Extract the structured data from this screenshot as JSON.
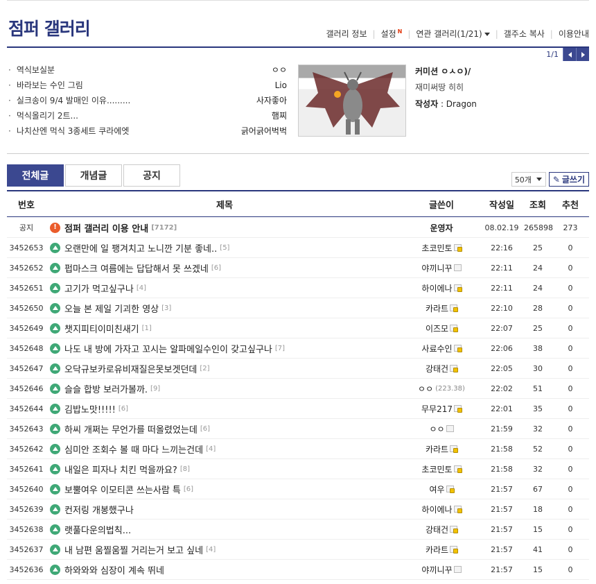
{
  "gallery": {
    "title": "점퍼 갤러리",
    "menu": [
      "갤러리 정보",
      "설정",
      "연관 갤러리(1/21)",
      "갤주소 복사",
      "이용안내"
    ],
    "settings_new_mark": "N",
    "pager": "1/1"
  },
  "concept_list": [
    {
      "title": "역식보실분",
      "author": "ㅇㅇ"
    },
    {
      "title": "바라보는 수인 그림",
      "author": "Lio"
    },
    {
      "title": "실크송이 9/4 발매인 이유.........",
      "author": "사자좋아"
    },
    {
      "title": "먹식올리기 2트...",
      "author": "햄찌"
    },
    {
      "title": "나치산엔 먹식 3종세트 쿠라에엣",
      "author": "긁어긁어벅벅"
    }
  ],
  "featured": {
    "title": "커미션 ㅇㅅㅇ)/",
    "subtitle": "재미써땅 히히",
    "author_label": "작성자",
    "author": ": Dragon"
  },
  "tabs": [
    "전체글",
    "개념글",
    "공지"
  ],
  "list_count": "50개",
  "write_label": "글쓰기",
  "columns": [
    "번호",
    "제목",
    "글쓴이",
    "작성일",
    "조회",
    "추천"
  ],
  "notice": {
    "num": "공지",
    "title": "점퍼 갤러리 이용 안내",
    "reply": "[7172]",
    "writer": "운영자",
    "date": "08.02.19",
    "views": "265898",
    "rec": "273"
  },
  "posts": [
    {
      "num": "3452653",
      "title": "오랜만에 일 팽겨치고 노니깐 기분 좋네..",
      "reply": "[5]",
      "writer": "초코민토",
      "badge": "fix",
      "date": "22:16",
      "views": "25",
      "rec": "0"
    },
    {
      "num": "3452652",
      "title": "펍마스크 여름에는 답답해서 못 쓰겠네",
      "reply": "[6]",
      "writer": "야끼니꾸",
      "badge": "plain",
      "date": "22:11",
      "views": "24",
      "rec": "0"
    },
    {
      "num": "3452651",
      "title": "고기가 먹고싶구나",
      "reply": "[4]",
      "writer": "하이에나",
      "badge": "fix",
      "date": "22:11",
      "views": "24",
      "rec": "0"
    },
    {
      "num": "3452650",
      "title": "오늘 본 제일 기괴한 영상",
      "reply": "[3]",
      "writer": "카라트",
      "badge": "fix",
      "date": "22:10",
      "views": "28",
      "rec": "0"
    },
    {
      "num": "3452649",
      "title": "챗지피티이미친새기",
      "reply": "[1]",
      "writer": "이즈모",
      "badge": "fix",
      "date": "22:07",
      "views": "25",
      "rec": "0"
    },
    {
      "num": "3452648",
      "title": "나도 내 방에 가자고 꼬시는 알파메일수인이 갖고싶구나",
      "reply": "[7]",
      "writer": "사료수인",
      "badge": "fix",
      "date": "22:06",
      "views": "38",
      "rec": "0"
    },
    {
      "num": "3452647",
      "title": "오닥규보카로유비재질은못보겟던데",
      "reply": "[2]",
      "writer": "강태건",
      "badge": "fix",
      "date": "22:05",
      "views": "30",
      "rec": "0"
    },
    {
      "num": "3452646",
      "title": "슬슬 합방 보러가볼까.",
      "reply": "[9]",
      "writer": "ㅇㅇ",
      "ip": "(223.38)",
      "badge": "",
      "date": "22:02",
      "views": "51",
      "rec": "0"
    },
    {
      "num": "3452644",
      "title": "김밥노맛!!!!!",
      "reply": "[6]",
      "writer": "무무217",
      "badge": "fix",
      "date": "22:01",
      "views": "35",
      "rec": "0"
    },
    {
      "num": "3452643",
      "title": "하씨 개쩌는 무언가를 떠올렸었는데",
      "reply": "[6]",
      "writer": "ㅇㅇ",
      "badge": "plain",
      "date": "21:59",
      "views": "32",
      "rec": "0"
    },
    {
      "num": "3452642",
      "title": "심미안 조회수 볼 때 마다 느끼는건데",
      "reply": "[4]",
      "writer": "카라트",
      "badge": "fix",
      "date": "21:58",
      "views": "52",
      "rec": "0"
    },
    {
      "num": "3452641",
      "title": "내일은 피자나 치킨 먹을까요?",
      "reply": "[8]",
      "writer": "초코민토",
      "badge": "fix",
      "date": "21:58",
      "views": "32",
      "rec": "0"
    },
    {
      "num": "3452640",
      "title": "보뿔여우 이모티콘 쓰는사람 특",
      "reply": "[6]",
      "writer": "여우",
      "badge": "fix",
      "date": "21:57",
      "views": "67",
      "rec": "0"
    },
    {
      "num": "3452639",
      "title": "컨저링 개봉했구나",
      "reply": "",
      "writer": "하이에나",
      "badge": "fix",
      "date": "21:57",
      "views": "18",
      "rec": "0"
    },
    {
      "num": "3452638",
      "title": "랫풀다운의법칙...",
      "reply": "",
      "writer": "강태건",
      "badge": "fix",
      "date": "21:57",
      "views": "15",
      "rec": "0"
    },
    {
      "num": "3452637",
      "title": "내 남편 움찔움찔 거리는거 보고 싶네",
      "reply": "[4]",
      "writer": "카라트",
      "badge": "fix",
      "date": "21:57",
      "views": "41",
      "rec": "0"
    },
    {
      "num": "3452636",
      "title": "하와와와 심장이 계속 뛰네",
      "reply": "",
      "writer": "야끼니꾸",
      "badge": "plain",
      "date": "21:57",
      "views": "15",
      "rec": "0"
    }
  ],
  "colors": {
    "brand": "#29367c",
    "tab_active": "#3b4890",
    "post_icon": "#3fa876",
    "notice_icon": "#ea5c2b"
  }
}
